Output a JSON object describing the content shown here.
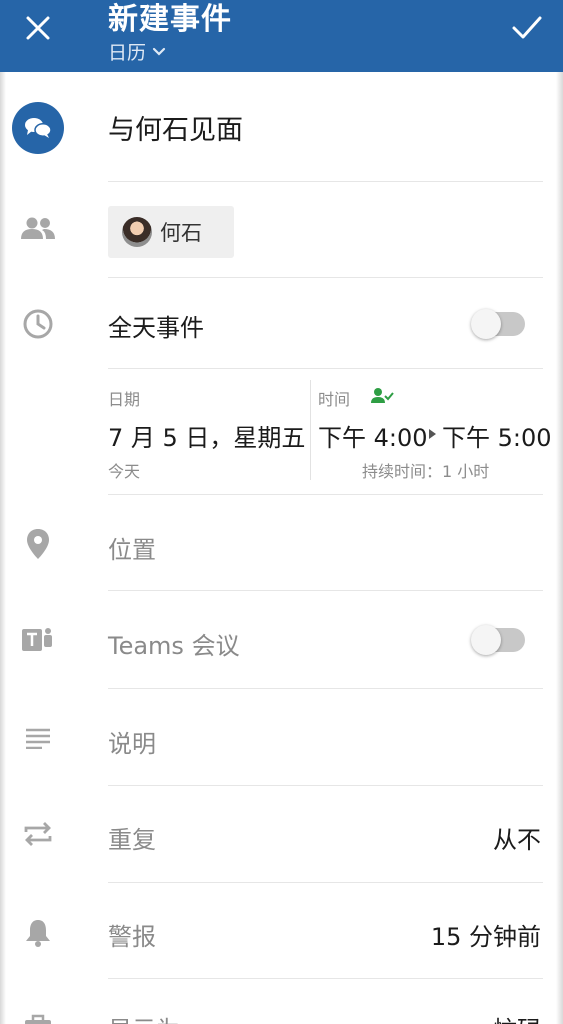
{
  "header": {
    "title": "新建事件",
    "calendar_label": "日历",
    "close_icon": "close-icon",
    "confirm_icon": "checkmark-icon",
    "color": "#2665a8"
  },
  "event": {
    "title": "与何石见面"
  },
  "attendees": [
    {
      "name": "何石"
    }
  ],
  "all_day": {
    "label": "全天事件",
    "enabled": false
  },
  "datetime": {
    "date_label": "日期",
    "date_value": "7 月 5 日，星期五",
    "date_hint": "今天",
    "time_label": "时间",
    "start": "下午 4:00",
    "end": "下午 5:00",
    "duration": "持续时间：1 小时"
  },
  "location": {
    "placeholder": "位置"
  },
  "teams": {
    "label": "Teams 会议",
    "enabled": false
  },
  "description": {
    "placeholder": "说明"
  },
  "repeat": {
    "label": "重复",
    "value": "从不"
  },
  "alert": {
    "label": "警报",
    "value": "15 分钟前"
  },
  "show_as": {
    "label": "显示为",
    "value": "忙碌"
  }
}
